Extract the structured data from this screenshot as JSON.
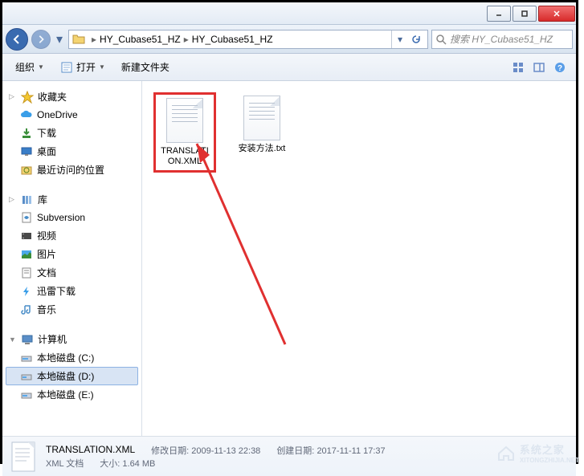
{
  "breadcrumbs": [
    "HY_Cubase51_HZ",
    "HY_Cubase51_HZ"
  ],
  "search": {
    "placeholder": "搜索 HY_Cubase51_HZ"
  },
  "toolbar": {
    "organize": "组织",
    "open": "打开",
    "newfolder": "新建文件夹"
  },
  "sidebar": {
    "favorites": {
      "label": "收藏夹",
      "items": [
        "OneDrive",
        "下载",
        "桌面",
        "最近访问的位置"
      ]
    },
    "libraries": {
      "label": "库",
      "items": [
        "Subversion",
        "视频",
        "图片",
        "文档",
        "迅雷下载",
        "音乐"
      ]
    },
    "computer": {
      "label": "计算机",
      "items": [
        "本地磁盘 (C:)",
        "本地磁盘 (D:)",
        "本地磁盘 (E:)"
      ],
      "selected_index": 1
    }
  },
  "files": [
    {
      "name": "TRANSLATION.XML",
      "selected": true
    },
    {
      "name": "安装方法.txt",
      "selected": false
    }
  ],
  "details": {
    "filename": "TRANSLATION.XML",
    "type": "XML 文档",
    "modified_label": "修改日期:",
    "modified": "2009-11-13 22:38",
    "size_label": "大小:",
    "size": "1.64 MB",
    "created_label": "创建日期:",
    "created": "2017-11-11 17:37"
  },
  "watermark": {
    "cn": "系统之家",
    "en": "XITONGZHIJIA.NET"
  }
}
